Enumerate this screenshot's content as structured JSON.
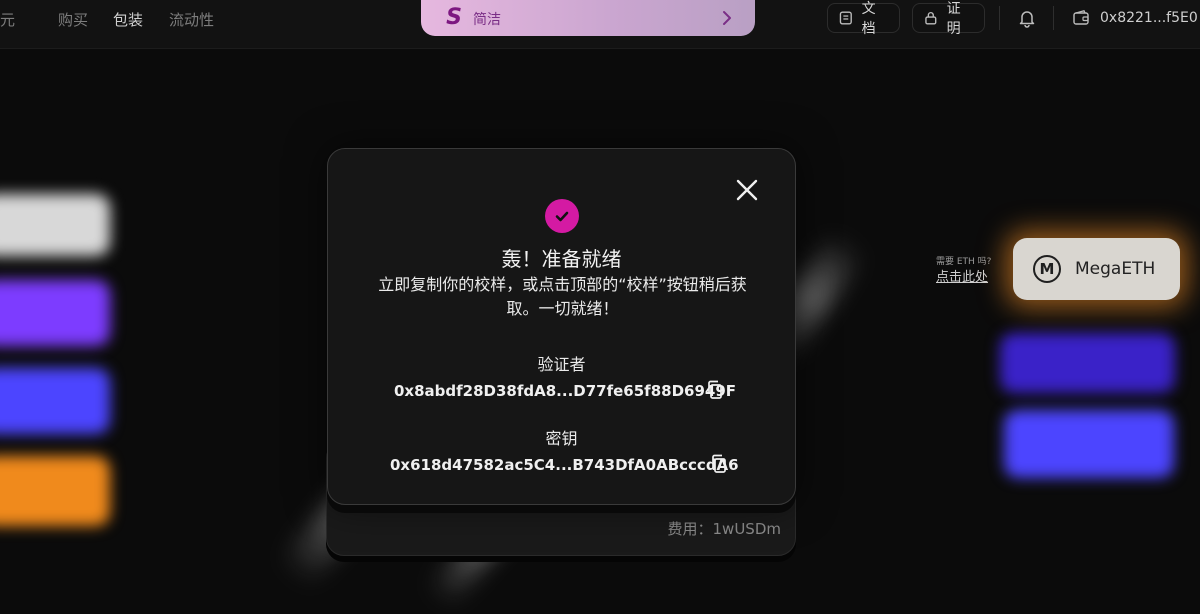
{
  "nav": {
    "items": [
      {
        "label": "元",
        "active": false
      },
      {
        "label": "购买",
        "active": false
      },
      {
        "label": "包装",
        "active": true
      },
      {
        "label": "流动性",
        "active": false
      }
    ]
  },
  "banner": {
    "label": "简洁",
    "logo": "S"
  },
  "header": {
    "docs_label": "文档",
    "proof_label": "证明",
    "wallet_address": "0x8221...f5E0"
  },
  "side": {
    "need_eth": "需要 ETH 吗?",
    "need_eth_link": "点击此处",
    "network_label": "MegaETH",
    "network_logo": "M"
  },
  "modal": {
    "title": "轰！准备就绪",
    "message": "立即复制你的校样，或点击顶部的“校样”按钮稍后获取。一切就绪！",
    "verifier_label": "验证者",
    "verifier_value": "0x8abdf28D38fdA8...D77fe65f88D6949F",
    "key_label": "密钥",
    "key_value": "0x618d47582ac5C4...B743DfA0ABcccdA6",
    "fee_text": "费用：1wUSDm"
  },
  "colors": {
    "accent": "#d41aa3",
    "banner": "#e6b8df",
    "network_glow": "#ff9628",
    "purple_button": "#7d3cff",
    "blue_button": "#4c45ff",
    "orange_button": "#f08a1c"
  }
}
